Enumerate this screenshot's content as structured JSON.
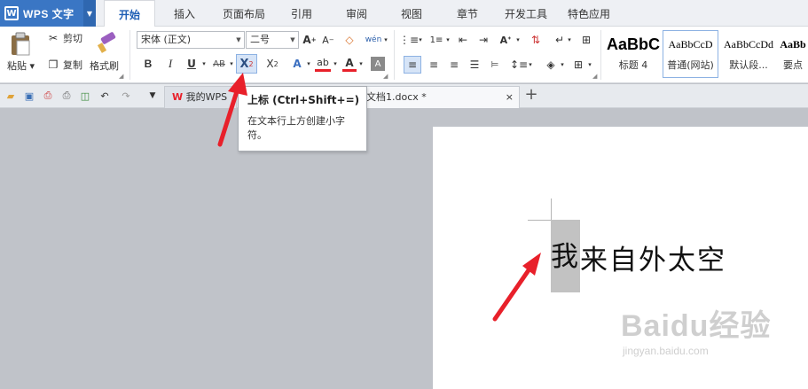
{
  "app": {
    "logo": "W",
    "title": "WPS 文字"
  },
  "menu_tabs": [
    "开始",
    "插入",
    "页面布局",
    "引用",
    "审阅",
    "视图",
    "章节",
    "开发工具",
    "特色应用"
  ],
  "ribbon": {
    "paste": "粘贴",
    "cut": "剪切",
    "copy": "复制",
    "format_painter": "格式刷",
    "font_name": "宋体 (正文)",
    "font_size": "二号",
    "bold": "B",
    "italic": "I",
    "underline": "U",
    "strikethrough": "AB",
    "superscript_base": "X",
    "superscript_mark": "2",
    "subscript_base": "X",
    "subscript_mark": "2",
    "font_color_label": "A",
    "styles": [
      {
        "preview": "AaBbC",
        "name": "标题 4"
      },
      {
        "preview": "AaBbCcD",
        "name": "普通(网站)"
      },
      {
        "preview": "AaBbCcDd",
        "name": "默认段..."
      },
      {
        "preview": "AaBb",
        "name": "要点"
      }
    ]
  },
  "doc_tabs": [
    {
      "label": "我的WPS"
    },
    {
      "label": "文档1.docx *",
      "close": "×"
    }
  ],
  "new_tab": "+",
  "tooltip": {
    "title": "上标 (Ctrl+Shift+=)",
    "body": "在文本行上方创建小字符。"
  },
  "document": {
    "selected_char": "我",
    "rest_text": "来自外太空"
  },
  "watermark": {
    "brand": "Baidu经验",
    "url": "jingyan.baidu.com"
  },
  "colors": {
    "accent": "#3a76c4",
    "arrow": "#e8202a",
    "selection": "#c2c2c2"
  }
}
